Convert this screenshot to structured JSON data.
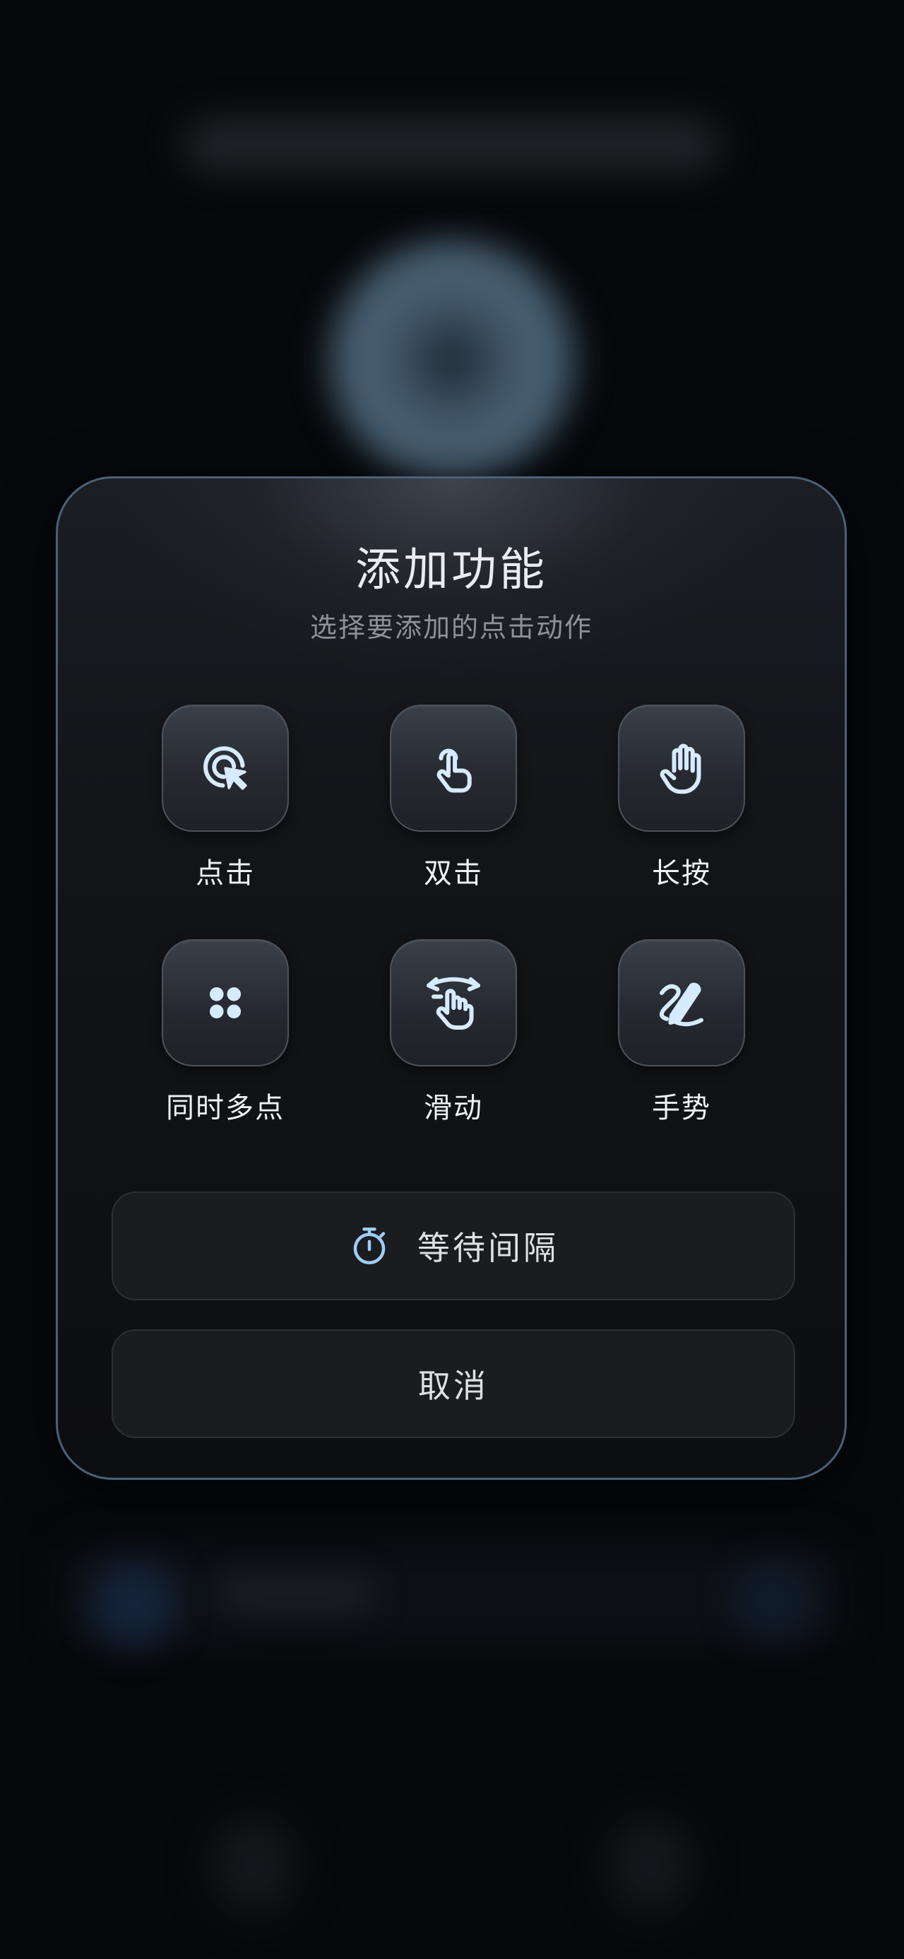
{
  "dialog": {
    "title": "添加功能",
    "subtitle": "选择要添加的点击动作"
  },
  "actions": [
    {
      "label": "点击",
      "icon": "tap-cursor-icon"
    },
    {
      "label": "双击",
      "icon": "double-tap-icon"
    },
    {
      "label": "长按",
      "icon": "hand-icon"
    },
    {
      "label": "同时多点",
      "icon": "multi-dot-icon"
    },
    {
      "label": "滑动",
      "icon": "swipe-icon"
    },
    {
      "label": "手势",
      "icon": "gesture-pen-icon"
    }
  ],
  "wait_button": {
    "label": "等待间隔",
    "icon": "timer-icon"
  },
  "cancel_button": {
    "label": "取消"
  },
  "colors": {
    "accent": "#9fcdf7",
    "dialog_border": "#4a6178",
    "background": "#06080b"
  }
}
